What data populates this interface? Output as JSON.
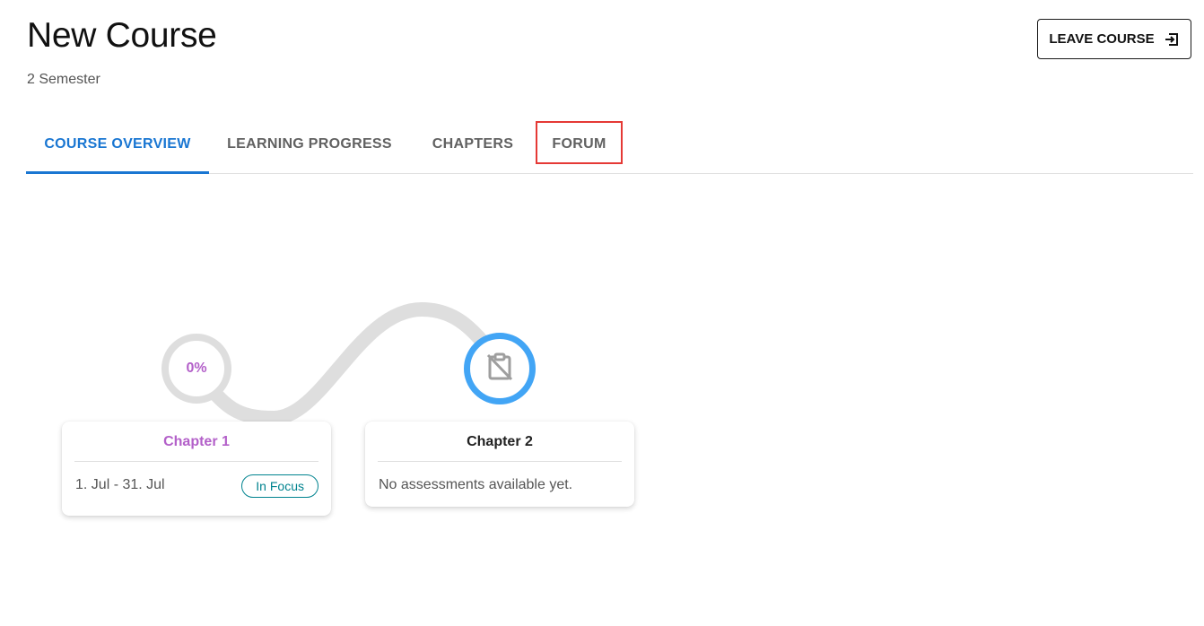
{
  "header": {
    "title": "New Course",
    "subtitle": "2 Semester",
    "leave_button_label": "LEAVE COURSE",
    "leave_button_icon": "exit-icon"
  },
  "tabs": [
    {
      "label": "COURSE OVERVIEW",
      "active": true
    },
    {
      "label": "LEARNING PROGRESS",
      "active": false
    },
    {
      "label": "CHAPTERS",
      "active": false
    },
    {
      "label": "FORUM",
      "active": false,
      "highlighted": true
    }
  ],
  "chapters": [
    {
      "title": "Chapter 1",
      "progress_label": "0%",
      "progress": 0,
      "date_range": "1. Jul - 31. Jul",
      "badge": "In Focus"
    },
    {
      "title": "Chapter 2",
      "status_icon": "no-assessment-clipboard-icon",
      "message": "No assessments available yet."
    }
  ],
  "colors": {
    "accent": "#1976d2",
    "chapter_1": "#b360c9",
    "badge": "#00838f",
    "status_ring": "#42a5f5",
    "highlight_outline": "#e53935",
    "path": "#dedede"
  }
}
